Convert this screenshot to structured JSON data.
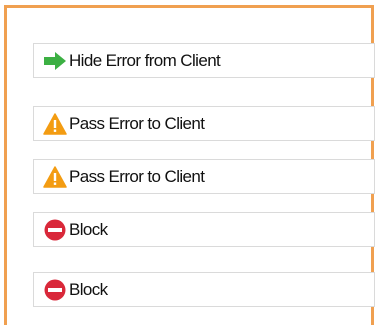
{
  "rules": [
    {
      "label": "Hide Error from Client",
      "icon": "green-arrow-right-icon"
    },
    {
      "label": "Pass Error to Client",
      "icon": "warning-triangle-icon"
    },
    {
      "label": "Pass Error to Client",
      "icon": "warning-triangle-icon"
    },
    {
      "label": "Block",
      "icon": "block-icon"
    },
    {
      "label": "Block",
      "icon": "block-icon"
    }
  ],
  "colors": {
    "frame_border": "#f0a050",
    "item_border": "#dadada",
    "arrow_green": "#3cb043",
    "warning_orange": "#f39c12",
    "block_red": "#d9283a"
  }
}
